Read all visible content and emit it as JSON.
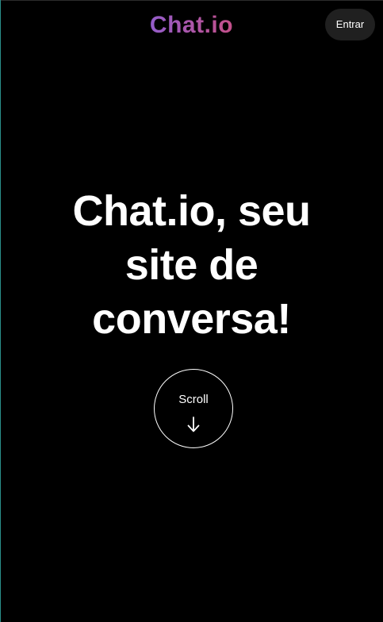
{
  "header": {
    "logo_text": "Chat.io",
    "login_label": "Entrar"
  },
  "hero": {
    "title": "Chat.io, seu site de conversa!",
    "scroll_label": "Scroll",
    "scroll_icon": "arrow-down-icon"
  },
  "colors": {
    "background": "#000000",
    "text": "#ffffff",
    "button_bg": "#202020",
    "logo_gradient": [
      "#5b7be8",
      "#8a5fd6",
      "#d94a6e",
      "#e8344f"
    ]
  }
}
